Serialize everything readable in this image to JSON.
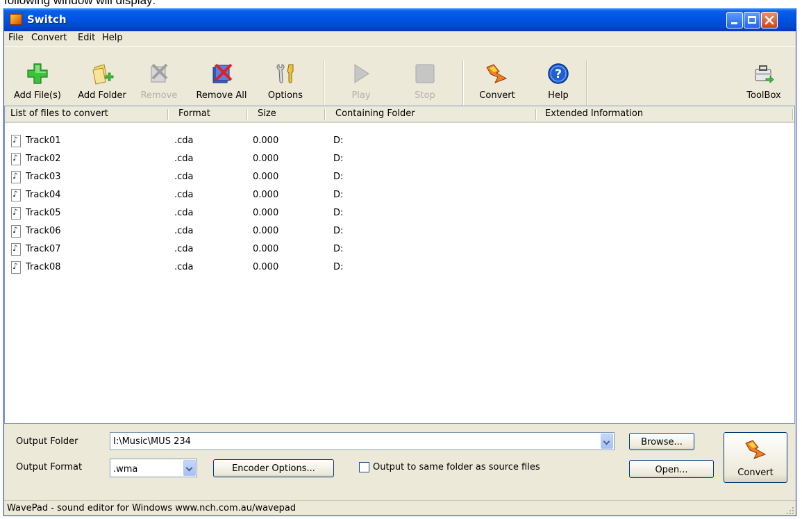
{
  "caption": "following window will display:",
  "window": {
    "title": "Switch",
    "controls": [
      "minimize",
      "maximize",
      "close"
    ]
  },
  "menu": [
    "File",
    "Convert",
    "Edit",
    "Help"
  ],
  "toolbar": {
    "add_files": "Add File(s)",
    "add_folder": "Add Folder",
    "remove": "Remove",
    "remove_all": "Remove All",
    "options": "Options",
    "play": "Play",
    "stop": "Stop",
    "convert": "Convert",
    "help": "Help",
    "toolbox": "ToolBox"
  },
  "list": {
    "columns": [
      "List of files to convert",
      "Format",
      "Size",
      "Containing Folder",
      "Extended Information"
    ],
    "rows": [
      {
        "name": "Track01",
        "format": ".cda",
        "size": "0.000",
        "folder": "D:",
        "info": ""
      },
      {
        "name": "Track02",
        "format": ".cda",
        "size": "0.000",
        "folder": "D:",
        "info": ""
      },
      {
        "name": "Track03",
        "format": ".cda",
        "size": "0.000",
        "folder": "D:",
        "info": ""
      },
      {
        "name": "Track04",
        "format": ".cda",
        "size": "0.000",
        "folder": "D:",
        "info": ""
      },
      {
        "name": "Track05",
        "format": ".cda",
        "size": "0.000",
        "folder": "D:",
        "info": ""
      },
      {
        "name": "Track06",
        "format": ".cda",
        "size": "0.000",
        "folder": "D:",
        "info": ""
      },
      {
        "name": "Track07",
        "format": ".cda",
        "size": "0.000",
        "folder": "D:",
        "info": ""
      },
      {
        "name": "Track08",
        "format": ".cda",
        "size": "0.000",
        "folder": "D:",
        "info": ""
      }
    ]
  },
  "output": {
    "folder_label": "Output Folder",
    "folder_value": "I:\\Music\\MUS 234",
    "format_label": "Output Format",
    "format_value": ".wma",
    "encoder_options": "Encoder Options...",
    "same_folder_label": "Output to same folder as source files",
    "same_folder_checked": false,
    "browse": "Browse...",
    "open": "Open...",
    "convert": "Convert"
  },
  "status": "WavePad - sound editor for Windows www.nch.com.au/wavepad",
  "colors": {
    "titlebar": "#0055e5",
    "window_bg": "#ece9d8",
    "list_bg": "#ffffff",
    "close_button": "#d24317"
  }
}
